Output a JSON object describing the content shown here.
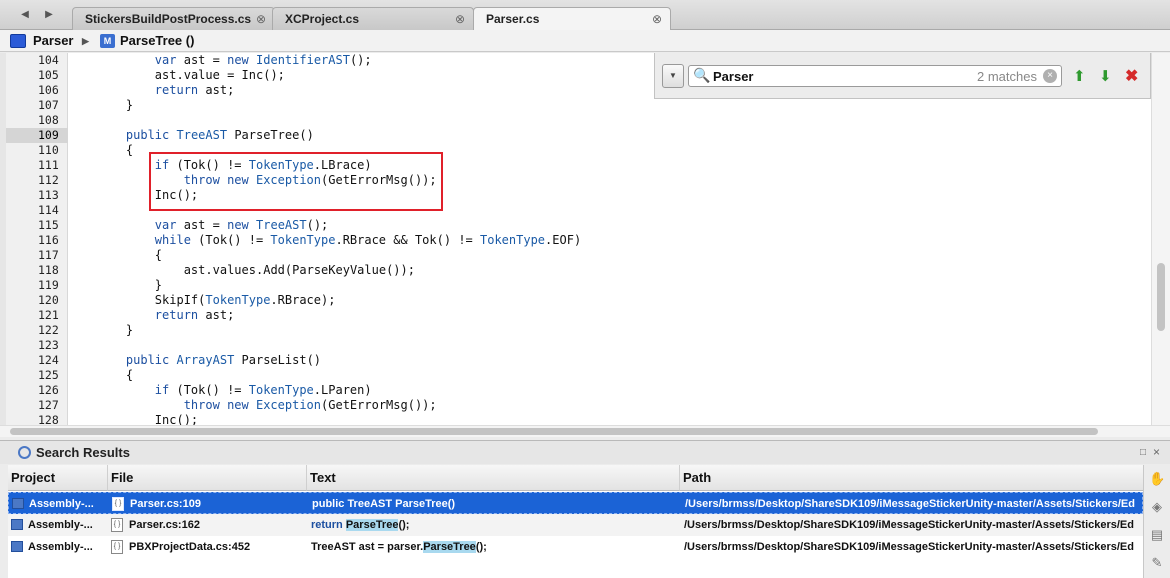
{
  "tabs": [
    {
      "label": "StickersBuildPostProcess.cs",
      "close": "⊗",
      "active": false
    },
    {
      "label": "XCProject.cs",
      "close": "⊗",
      "active": false
    },
    {
      "label": "Parser.cs",
      "close": "⊗",
      "active": true
    }
  ],
  "nav": {
    "back": "◀",
    "forward": "▶"
  },
  "breadcrumb": {
    "class": "Parser",
    "separator": "▶",
    "method_icon": "M",
    "method": "ParseTree ()"
  },
  "code": {
    "current_line": 109,
    "lines": [
      {
        "n": "104",
        "text": "        var ast = new IdentifierAST();"
      },
      {
        "n": "105",
        "text": "        ast.value = Inc();"
      },
      {
        "n": "106",
        "text": "        return ast;"
      },
      {
        "n": "107",
        "text": "    }"
      },
      {
        "n": "108",
        "text": ""
      },
      {
        "n": "109",
        "text": "    public TreeAST ParseTree()"
      },
      {
        "n": "110",
        "text": "    {"
      },
      {
        "n": "111",
        "text": "        if (Tok() != TokenType.LBrace)"
      },
      {
        "n": "112",
        "text": "            throw new Exception(GetErrorMsg());"
      },
      {
        "n": "113",
        "text": "        Inc();"
      },
      {
        "n": "114",
        "text": ""
      },
      {
        "n": "115",
        "text": "        var ast = new TreeAST();"
      },
      {
        "n": "116",
        "text": "        while (Tok() != TokenType.RBrace && Tok() != TokenType.EOF)"
      },
      {
        "n": "117",
        "text": "        {"
      },
      {
        "n": "118",
        "text": "            ast.values.Add(ParseKeyValue());"
      },
      {
        "n": "119",
        "text": "        }"
      },
      {
        "n": "120",
        "text": "        SkipIf(TokenType.RBrace);"
      },
      {
        "n": "121",
        "text": "        return ast;"
      },
      {
        "n": "122",
        "text": "    }"
      },
      {
        "n": "123",
        "text": ""
      },
      {
        "n": "124",
        "text": "    public ArrayAST ParseList()"
      },
      {
        "n": "125",
        "text": "    {"
      },
      {
        "n": "126",
        "text": "        if (Tok() != TokenType.LParen)"
      },
      {
        "n": "127",
        "text": "            throw new Exception(GetErrorMsg());"
      },
      {
        "n": "128",
        "text": "        Inc();"
      }
    ]
  },
  "find": {
    "options": "▼",
    "search_icon": "🔍",
    "query": "Parser",
    "matches": "2 matches",
    "clear": "×",
    "prev": "⬆",
    "next": "⬇",
    "close": "✖"
  },
  "results": {
    "title": "Search Results",
    "panel_maximize": "□",
    "panel_close": "×",
    "columns": {
      "project": "Project",
      "file": "File",
      "text": "Text",
      "path": "Path"
    },
    "rows": [
      {
        "project": "Assembly-...",
        "file_icon": "{ }",
        "file": "Parser.cs:109",
        "text_before": "public TreeAST ParseTree()",
        "text_kw": "",
        "text_match": "",
        "text_after": "",
        "path": "/Users/brmss/Desktop/ShareSDK109/iMessageStickerUnity-master/Assets/Stickers/Ed",
        "selected": true
      },
      {
        "project": "Assembly-...",
        "file_icon": "{ }",
        "file": "Parser.cs:162",
        "text_before": "",
        "text_kw": "return ",
        "text_match": "ParseTree",
        "text_after": "();",
        "path": "/Users/brmss/Desktop/ShareSDK109/iMessageStickerUnity-master/Assets/Stickers/Ed",
        "selected": false
      },
      {
        "project": "Assembly-...",
        "file_icon": "{ }",
        "file": "PBXProjectData.cs:452",
        "text_before": "TreeAST ast = parser.",
        "text_kw": "",
        "text_match": "ParseTree",
        "text_after": "();",
        "path": "/Users/brmss/Desktop/ShareSDK109/iMessageStickerUnity-master/Assets/Stickers/Ed",
        "selected": false
      }
    ]
  },
  "toolstrip": {
    "icons": [
      {
        "name": "hand-icon",
        "glyph": "✋"
      },
      {
        "name": "eraser-icon",
        "glyph": "◈"
      },
      {
        "name": "terminal-icon",
        "glyph": "▤"
      },
      {
        "name": "pin-icon",
        "glyph": "✎"
      }
    ]
  },
  "colors": {
    "accent": "#1b63d6",
    "keyword": "#1c4fa0",
    "highlight_box": "#e0202a",
    "match_highlight": "#a9d9ef"
  }
}
